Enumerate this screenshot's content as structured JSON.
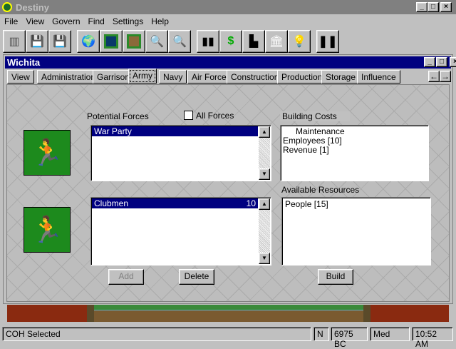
{
  "app": {
    "title": "Destiny"
  },
  "menu": [
    "File",
    "View",
    "Govern",
    "Find",
    "Settings",
    "Help"
  ],
  "toolbar": [
    "exit-icon",
    "save-icon",
    "load-icon",
    "globe-icon",
    "map-icon",
    "minimap-icon",
    "zoom-in-icon",
    "zoom-out-icon",
    "city-icon",
    "money-icon",
    "hat-icon",
    "capitol-icon",
    "lightbulb-icon",
    "pause-icon"
  ],
  "child": {
    "title": "Wichita",
    "tabs": [
      "View",
      "Administration",
      "Garrison",
      "Army",
      "Navy",
      "Air Force",
      "Construction",
      "Production",
      "Storage",
      "Influence"
    ],
    "active_tab": "Army"
  },
  "army": {
    "potential_label": "Potential Forces",
    "all_forces_label": "All Forces",
    "all_forces_checked": false,
    "potential_items": [
      "War Party"
    ],
    "building_costs_label": "Building Costs",
    "building_costs": [
      "Maintenance",
      "Employees [10]",
      "Revenue [1]"
    ],
    "units": [
      {
        "name": "Clubmen",
        "count": "10"
      }
    ],
    "available_label": "Available Resources",
    "available": [
      "People [15]"
    ],
    "add": "Add",
    "delete": "Delete",
    "build": "Build"
  },
  "status": {
    "message": "COH Selected",
    "dir": "N",
    "year": "6975 BC",
    "speed": "Med",
    "time": "10:52 AM"
  }
}
